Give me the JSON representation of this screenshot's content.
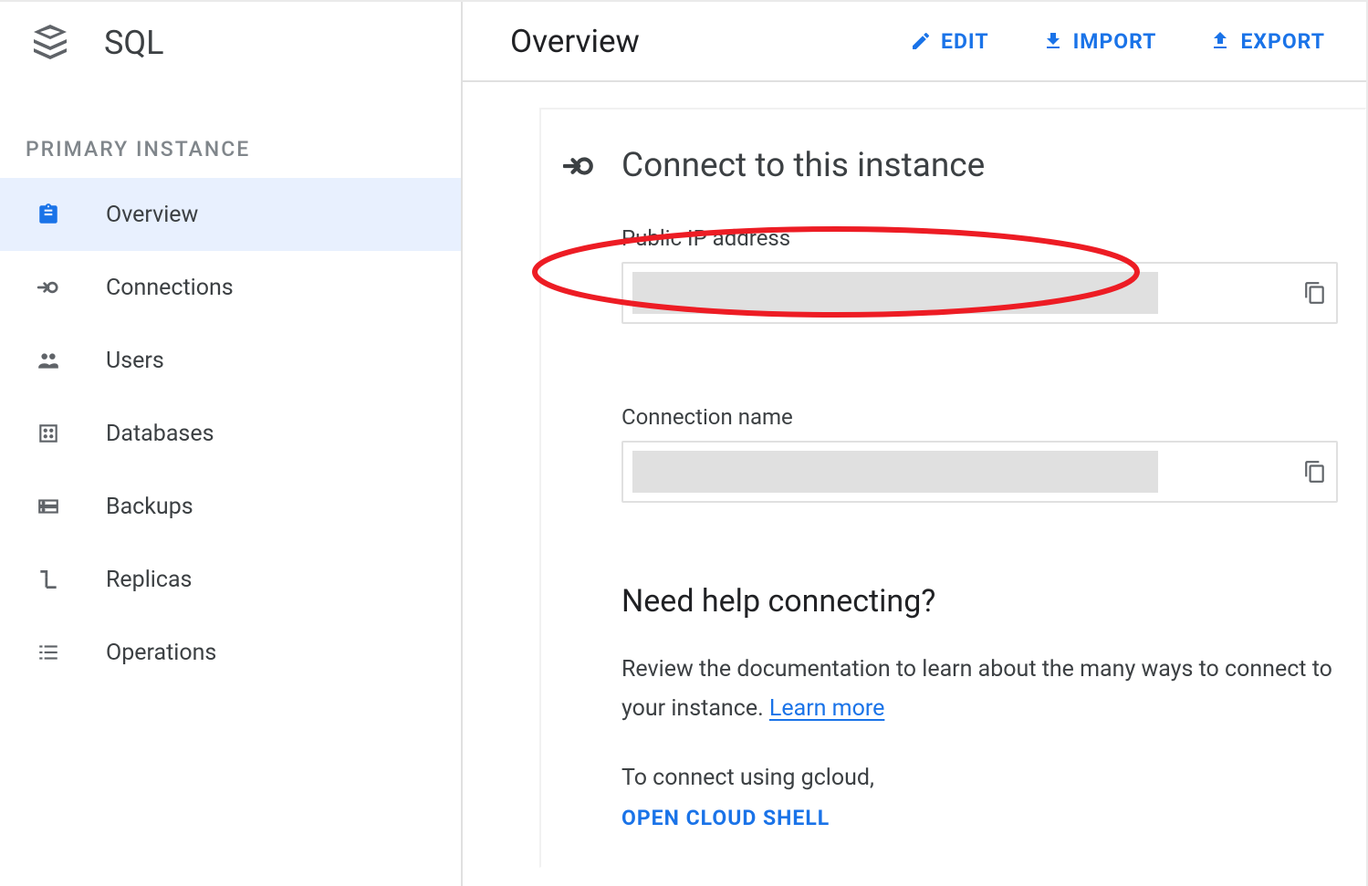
{
  "product": {
    "name": "SQL"
  },
  "sidebar": {
    "section_label": "PRIMARY INSTANCE",
    "items": [
      {
        "label": "Overview",
        "icon": "assignment-icon"
      },
      {
        "label": "Connections",
        "icon": "connection-icon"
      },
      {
        "label": "Users",
        "icon": "users-icon"
      },
      {
        "label": "Databases",
        "icon": "database-icon"
      },
      {
        "label": "Backups",
        "icon": "backups-icon"
      },
      {
        "label": "Replicas",
        "icon": "replicas-icon"
      },
      {
        "label": "Operations",
        "icon": "operations-icon"
      }
    ]
  },
  "header": {
    "title": "Overview",
    "actions": {
      "edit": "EDIT",
      "import": "IMPORT",
      "export": "EXPORT"
    }
  },
  "card": {
    "title": "Connect to this instance",
    "public_ip_label": "Public IP address",
    "public_ip_value": "",
    "connection_name_label": "Connection name",
    "connection_name_value": ""
  },
  "help": {
    "title": "Need help connecting?",
    "text_prefix": "Review the documentation to learn about the many ways to connect to your instance. ",
    "learn_more": "Learn more",
    "gcloud_prefix": "To connect using gcloud,",
    "open_cloud_shell": "OPEN CLOUD SHELL"
  },
  "annotation": {
    "color": "#ed1c24"
  }
}
